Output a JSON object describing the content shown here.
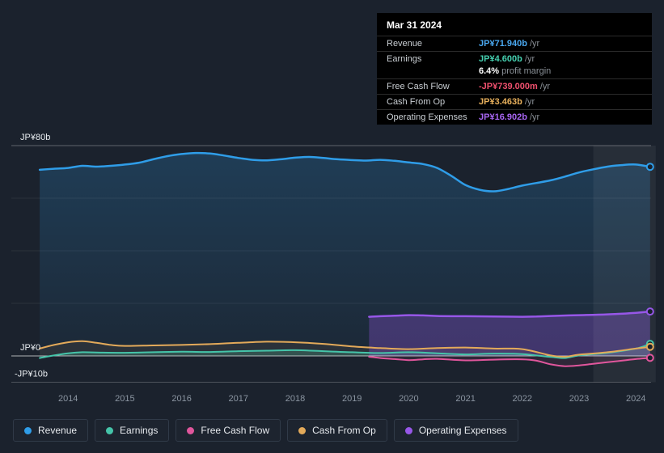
{
  "page": {
    "background": "#1b222d"
  },
  "tooltip": {
    "date": "Mar 31 2024",
    "rows": [
      {
        "label": "Revenue",
        "value": "JP¥71.940b",
        "unit": "/yr",
        "color": "#4aa8f0"
      },
      {
        "label": "Earnings",
        "value": "JP¥4.600b",
        "unit": "/yr",
        "color": "#45d0b0"
      },
      {
        "margin": true,
        "bold": "6.4%",
        "text": "profit margin"
      },
      {
        "label": "Free Cash Flow",
        "value": "-JP¥739.000m",
        "unit": "/yr",
        "color": "#f0506e"
      },
      {
        "label": "Cash From Op",
        "value": "JP¥3.463b",
        "unit": "/yr",
        "color": "#e8b05c"
      },
      {
        "label": "Operating Expenses",
        "value": "JP¥16.902b",
        "unit": "/yr",
        "color": "#a866f2"
      }
    ]
  },
  "legend": {
    "items": [
      {
        "key": "revenue",
        "label": "Revenue",
        "color": "#2f9de8"
      },
      {
        "key": "earnings",
        "label": "Earnings",
        "color": "#45c4a9"
      },
      {
        "key": "fcf",
        "label": "Free Cash Flow",
        "color": "#e0569c"
      },
      {
        "key": "cashop",
        "label": "Cash From Op",
        "color": "#e3aa5a"
      },
      {
        "key": "opex",
        "label": "Operating Expenses",
        "color": "#9757e8"
      }
    ]
  },
  "chart_data": {
    "type": "line",
    "title": "Earnings and Revenue History",
    "unit": "JP¥ billions per year",
    "xlim": [
      2013.45,
      2024.35
    ],
    "ylim": [
      -10,
      80
    ],
    "x_ticks": [
      2014,
      2015,
      2016,
      2017,
      2018,
      2019,
      2020,
      2021,
      2022,
      2023,
      2024
    ],
    "y_ticks": [
      {
        "label": "JP¥80b",
        "value": 80
      },
      {
        "label": "JP¥0",
        "value": 0
      },
      {
        "label": "-JP¥10b",
        "value": -10
      }
    ],
    "y_gridlines": [
      80,
      60,
      40,
      20,
      0,
      -10
    ],
    "highlight_band": {
      "from": 2023.25,
      "to": 2024.35
    },
    "series": [
      {
        "key": "revenue",
        "name": "Revenue",
        "color": "#2f9de8",
        "points": [
          [
            2013.5,
            70.8
          ],
          [
            2013.75,
            71.2
          ],
          [
            2014.0,
            71.5
          ],
          [
            2014.25,
            72.3
          ],
          [
            2014.5,
            72.0
          ],
          [
            2014.75,
            72.3
          ],
          [
            2015.0,
            72.8
          ],
          [
            2015.25,
            73.5
          ],
          [
            2015.5,
            74.8
          ],
          [
            2015.75,
            76.0
          ],
          [
            2016.0,
            76.8
          ],
          [
            2016.25,
            77.2
          ],
          [
            2016.5,
            77.0
          ],
          [
            2016.75,
            76.2
          ],
          [
            2017.0,
            75.3
          ],
          [
            2017.25,
            74.6
          ],
          [
            2017.5,
            74.4
          ],
          [
            2017.75,
            74.8
          ],
          [
            2018.0,
            75.4
          ],
          [
            2018.25,
            75.7
          ],
          [
            2018.5,
            75.3
          ],
          [
            2018.75,
            74.8
          ],
          [
            2019.0,
            74.5
          ],
          [
            2019.25,
            74.3
          ],
          [
            2019.5,
            74.6
          ],
          [
            2019.75,
            74.2
          ],
          [
            2020.0,
            73.6
          ],
          [
            2020.25,
            73.0
          ],
          [
            2020.5,
            71.5
          ],
          [
            2020.75,
            68.5
          ],
          [
            2021.0,
            65.0
          ],
          [
            2021.25,
            63.2
          ],
          [
            2021.5,
            62.6
          ],
          [
            2021.75,
            63.5
          ],
          [
            2022.0,
            64.8
          ],
          [
            2022.25,
            65.8
          ],
          [
            2022.5,
            66.8
          ],
          [
            2022.75,
            68.2
          ],
          [
            2023.0,
            69.8
          ],
          [
            2023.25,
            71.0
          ],
          [
            2023.5,
            72.0
          ],
          [
            2023.75,
            72.6
          ],
          [
            2024.0,
            72.8
          ],
          [
            2024.25,
            71.94
          ]
        ]
      },
      {
        "key": "earnings",
        "name": "Earnings",
        "color": "#45c4a9",
        "points": [
          [
            2013.5,
            -0.8
          ],
          [
            2013.75,
            0.2
          ],
          [
            2014.0,
            1.0
          ],
          [
            2014.25,
            1.4
          ],
          [
            2014.5,
            1.3
          ],
          [
            2015.0,
            1.2
          ],
          [
            2015.5,
            1.4
          ],
          [
            2016.0,
            1.6
          ],
          [
            2016.5,
            1.5
          ],
          [
            2017.0,
            1.8
          ],
          [
            2017.5,
            2.0
          ],
          [
            2018.0,
            2.2
          ],
          [
            2018.5,
            1.8
          ],
          [
            2019.0,
            1.4
          ],
          [
            2019.5,
            1.1
          ],
          [
            2020.0,
            1.4
          ],
          [
            2020.5,
            1.0
          ],
          [
            2021.0,
            0.6
          ],
          [
            2021.5,
            0.9
          ],
          [
            2022.0,
            0.7
          ],
          [
            2022.5,
            -0.4
          ],
          [
            2022.75,
            -0.8
          ],
          [
            2023.0,
            0.2
          ],
          [
            2023.5,
            1.2
          ],
          [
            2024.0,
            2.8
          ],
          [
            2024.25,
            4.6
          ]
        ]
      },
      {
        "key": "cashop",
        "name": "Cash From Op",
        "color": "#e3aa5a",
        "points": [
          [
            2013.5,
            2.8
          ],
          [
            2013.75,
            4.2
          ],
          [
            2014.0,
            5.2
          ],
          [
            2014.25,
            5.6
          ],
          [
            2014.5,
            5.0
          ],
          [
            2014.75,
            4.2
          ],
          [
            2015.0,
            3.8
          ],
          [
            2015.5,
            4.0
          ],
          [
            2016.0,
            4.2
          ],
          [
            2016.5,
            4.5
          ],
          [
            2017.0,
            5.0
          ],
          [
            2017.5,
            5.4
          ],
          [
            2018.0,
            5.2
          ],
          [
            2018.5,
            4.6
          ],
          [
            2019.0,
            3.6
          ],
          [
            2019.5,
            3.0
          ],
          [
            2020.0,
            2.6
          ],
          [
            2020.5,
            3.0
          ],
          [
            2021.0,
            3.2
          ],
          [
            2021.5,
            2.8
          ],
          [
            2022.0,
            2.6
          ],
          [
            2022.5,
            0.2
          ],
          [
            2022.75,
            -0.3
          ],
          [
            2023.0,
            0.5
          ],
          [
            2023.5,
            1.4
          ],
          [
            2024.0,
            2.8
          ],
          [
            2024.25,
            3.463
          ]
        ]
      },
      {
        "key": "fcf",
        "name": "Free Cash Flow",
        "color": "#e0569c",
        "points": [
          [
            2019.3,
            -0.3
          ],
          [
            2019.5,
            -0.8
          ],
          [
            2019.75,
            -1.2
          ],
          [
            2020.0,
            -1.6
          ],
          [
            2020.25,
            -1.3
          ],
          [
            2020.5,
            -1.1
          ],
          [
            2021.0,
            -1.7
          ],
          [
            2021.5,
            -1.4
          ],
          [
            2022.0,
            -1.3
          ],
          [
            2022.25,
            -1.8
          ],
          [
            2022.5,
            -3.2
          ],
          [
            2022.75,
            -3.9
          ],
          [
            2023.0,
            -3.6
          ],
          [
            2023.25,
            -3.0
          ],
          [
            2023.5,
            -2.4
          ],
          [
            2023.75,
            -1.8
          ],
          [
            2024.0,
            -1.2
          ],
          [
            2024.25,
            -0.739
          ]
        ]
      },
      {
        "key": "opex",
        "name": "Operating Expenses",
        "color": "#9757e8",
        "points": [
          [
            2019.3,
            14.9
          ],
          [
            2019.5,
            15.1
          ],
          [
            2019.75,
            15.3
          ],
          [
            2020.0,
            15.5
          ],
          [
            2020.25,
            15.4
          ],
          [
            2020.5,
            15.2
          ],
          [
            2021.0,
            15.1
          ],
          [
            2021.5,
            15.0
          ],
          [
            2022.0,
            14.9
          ],
          [
            2022.25,
            15.0
          ],
          [
            2022.5,
            15.2
          ],
          [
            2023.0,
            15.5
          ],
          [
            2023.5,
            15.8
          ],
          [
            2024.0,
            16.4
          ],
          [
            2024.25,
            16.902
          ]
        ]
      }
    ]
  }
}
